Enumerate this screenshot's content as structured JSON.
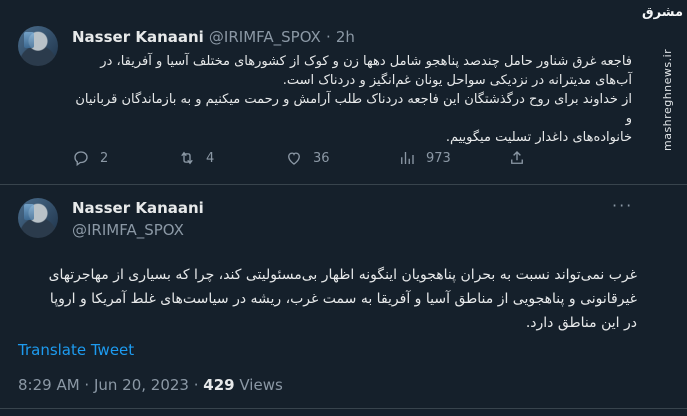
{
  "watermark": {
    "logo": "مشرق",
    "site": "mashreghnews.ir"
  },
  "tweet1": {
    "author_name": "Nasser Kanaani",
    "handle": "@IRIMFA_SPOX",
    "separator": "·",
    "time": "2h",
    "text_lines": [
      "فاجعه غرق شناور حامل چندصد پناهجو شامل دهها زن و کوک از کشورهای مختلف آسیا و آفریقا، در",
      "آب‌های مدیترانه در نزدیکی سواحل یونان غم‌انگیز و دردناک است.",
      "از خداوند برای روح درگذشتگان این فاجعه دردناک طلب آرامش و رحمت میکنیم و به بازماندگان قربانیان و",
      "خانواده‌های داغدار تسلیت میگوییم."
    ],
    "replies": "2",
    "retweets": "4",
    "likes": "36",
    "views": "973"
  },
  "tweet2": {
    "author_name": "Nasser Kanaani",
    "handle": "@IRIMFA_SPOX",
    "text_lines": [
      "غرب نمی‌تواند نسبت به بحران پناهجویان اینگونه اظهار بی‌مسئولیتی کند، چرا که بسیاری از مهاجرتهای",
      "غیرقانونی و پناهجویی از مناطق آسیا و آفریقا به سمت غرب، ریشه در سیاست‌های غلط آمریکا و اروپا",
      "در این مناطق دارد."
    ],
    "translate_label": "Translate Tweet",
    "timestamp": "8:29 AM · Jun 20, 2023 ·",
    "views_count": "429",
    "views_label": "Views"
  },
  "icons": [
    "more-icon",
    "reply-icon",
    "retweet-icon",
    "like-icon",
    "views-icon",
    "share-icon"
  ]
}
